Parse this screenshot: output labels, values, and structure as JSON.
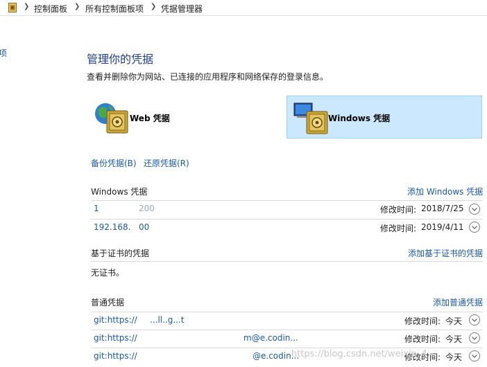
{
  "breadcrumb": {
    "items": [
      "控制面板",
      "所有控制面板项",
      "凭据管理器"
    ]
  },
  "side_cutoff": "项",
  "page": {
    "title": "管理你的凭据",
    "description": "查看并删除你为网站、已连接的应用程序和网络保存的登录信息。"
  },
  "tiles": {
    "web_label": "Web 凭据",
    "windows_label": "Windows 凭据"
  },
  "actions": {
    "backup": "备份凭据(B)",
    "restore": "还原凭据(R)"
  },
  "windows_section": {
    "heading": "Windows 凭据",
    "add_link": "添加 Windows 凭据",
    "rows": [
      {
        "name": "1",
        "name_tail": "200",
        "modified_label": "修改时间:",
        "modified": "2018/7/25"
      },
      {
        "name": "192.168.",
        "name_tail": "00",
        "modified_label": "修改时间:",
        "modified": "2019/4/11"
      }
    ]
  },
  "cert_section": {
    "heading": "基于证书的凭据",
    "add_link": "添加基于证书的凭据",
    "empty_text": "无证书。"
  },
  "generic_section": {
    "heading": "普通凭据",
    "add_link": "添加普通凭据",
    "rows": [
      {
        "name": "git:https://",
        "name_tail": "...ll..g...t",
        "modified_label": "修改时间:",
        "modified": "今天"
      },
      {
        "name": "git:https://",
        "name_tail": "m@e.codin...",
        "modified_label": "修改时间:",
        "modified": "今天"
      },
      {
        "name": "git:https://",
        "name_tail": "@e.codin...",
        "modified_label": "修改时间:",
        "modified": "今天"
      }
    ]
  },
  "watermark": "https://blog.csdn.net/weixin_4..."
}
